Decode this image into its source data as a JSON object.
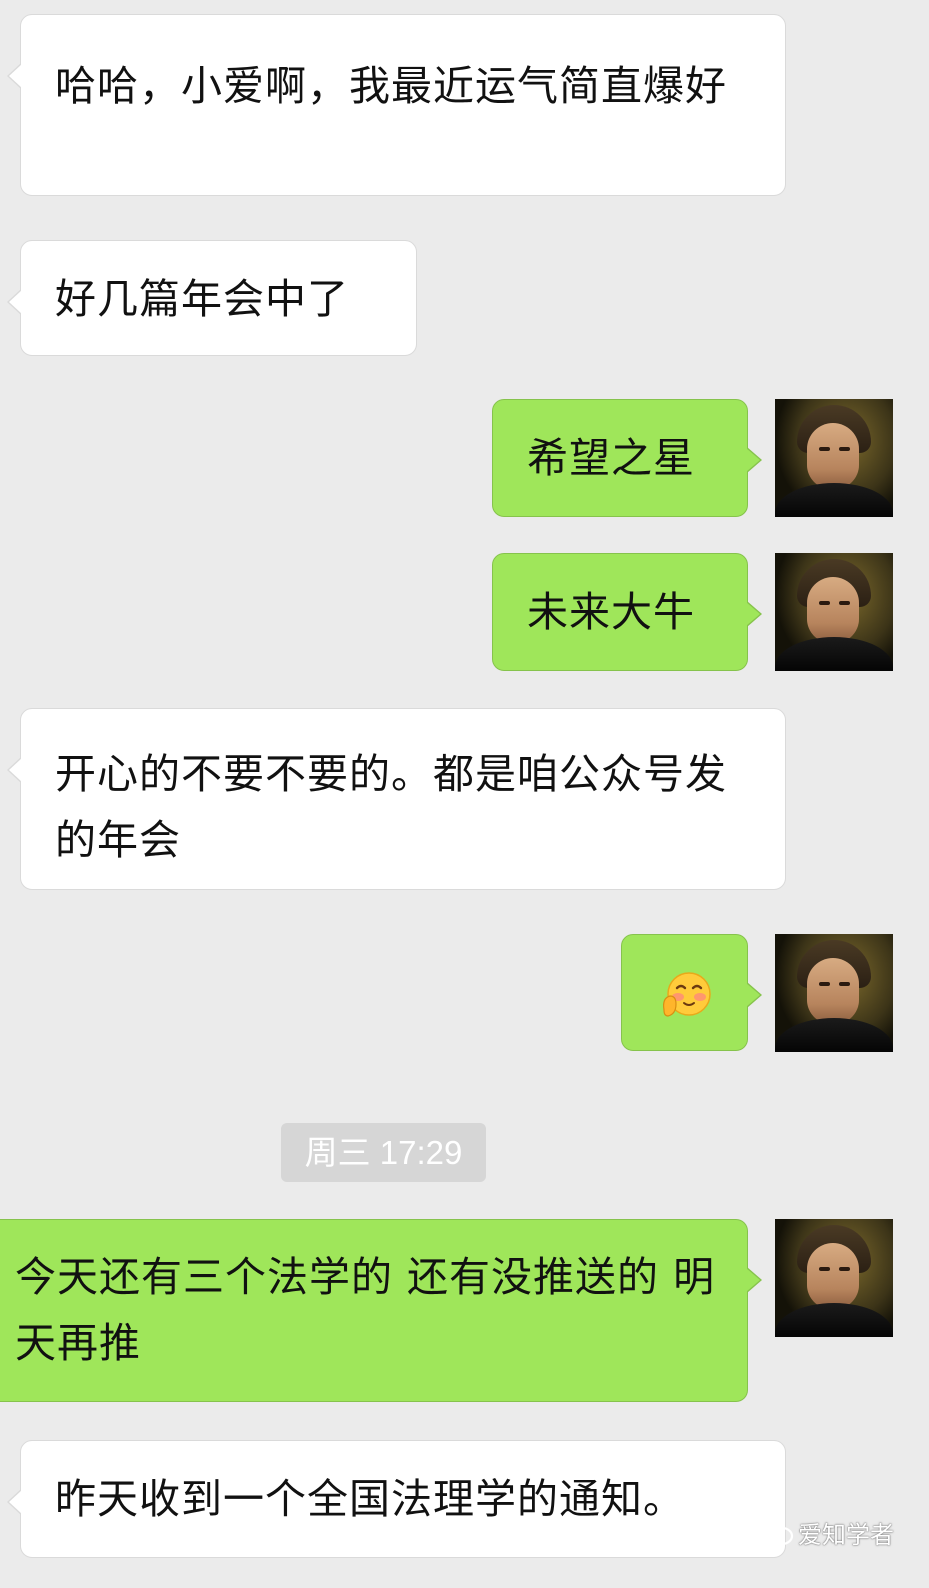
{
  "messages": [
    {
      "side": "in",
      "text": "哈哈，小爱啊，我最近运气简直爆好"
    },
    {
      "side": "in",
      "text": "好几篇年会中了"
    },
    {
      "side": "out",
      "text": "希望之星"
    },
    {
      "side": "out",
      "text": "未来大牛"
    },
    {
      "side": "in",
      "text": "开心的不要不要的。都是咱公众号发的年会"
    },
    {
      "side": "out",
      "emoji": "blushing-face-emoji"
    },
    {
      "side": "out",
      "text": "今天还有三个法学的 还有没推送的 明天再推"
    },
    {
      "side": "in",
      "text": "昨天收到一个全国法理学的通知。"
    }
  ],
  "timestamp": "周三 17:29",
  "watermark": "爱知学者",
  "colors": {
    "background": "#ebebeb",
    "incoming": "#ffffff",
    "outgoing": "#9fe65a",
    "timestamp_bg": "#d6d6d6"
  }
}
